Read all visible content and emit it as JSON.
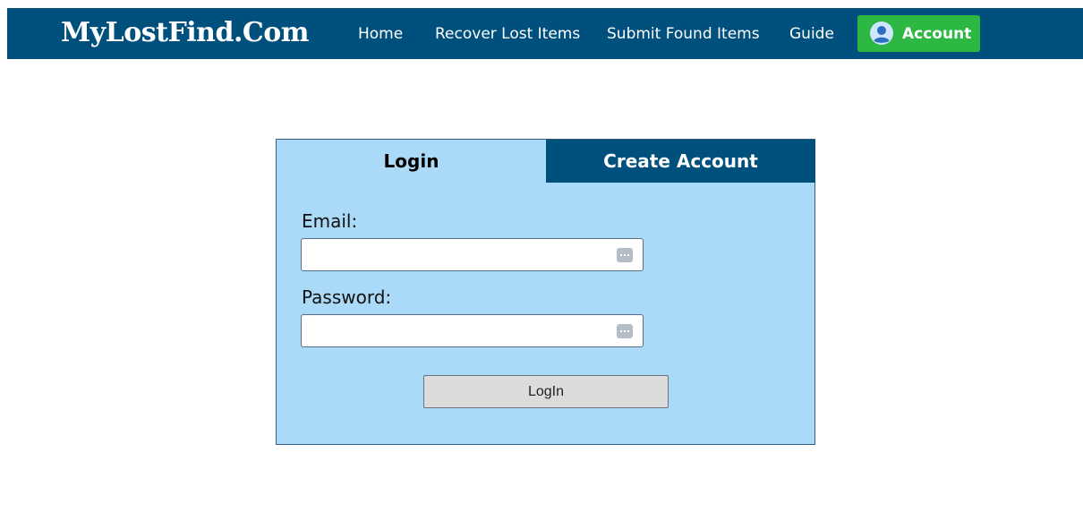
{
  "colors": {
    "navbar_bg": "#00507d",
    "account_button_bg": "#2db843",
    "panel_bg": "#aadaf7",
    "active_tab_bg": "#aadaf7",
    "inactive_tab_bg": "#00507d"
  },
  "header": {
    "brand": "MyLostFind.Com",
    "nav": {
      "home": "Home",
      "recover": "Recover Lost Items",
      "submit": "Submit Found Items",
      "guide": "Guide"
    },
    "account": {
      "label": "Account",
      "icon": "user-avatar-icon"
    }
  },
  "auth": {
    "tabs": {
      "login": "Login",
      "create": "Create Account"
    },
    "active_tab": "login",
    "email": {
      "label": "Email:",
      "value": "",
      "icon": "password-manager-icon"
    },
    "password": {
      "label": "Password:",
      "value": "",
      "icon": "password-manager-icon"
    },
    "submit_label": "LogIn"
  }
}
